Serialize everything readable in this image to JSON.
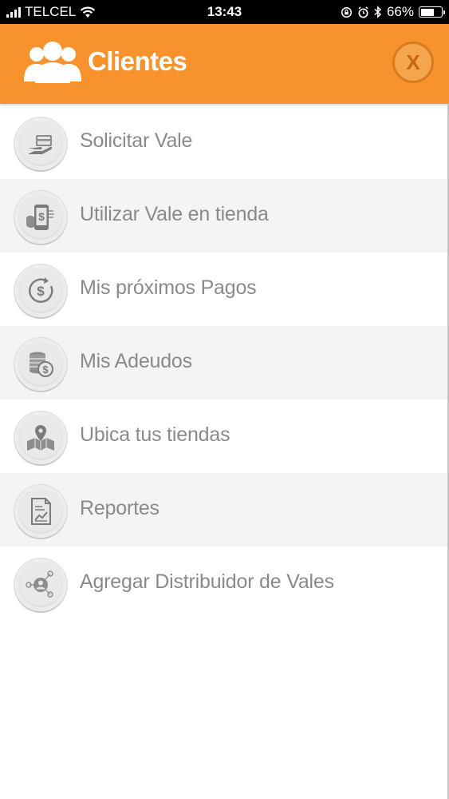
{
  "status_bar": {
    "carrier": "TELCEL",
    "time": "13:43",
    "battery_percent": "66%",
    "battery_level": 0.66
  },
  "header": {
    "title": "Clientes",
    "close_label": "X",
    "background_color": "#f7922c"
  },
  "menu": {
    "items": [
      {
        "label": "Solicitar Vale",
        "icon": "hand-card-icon"
      },
      {
        "label": "Utilizar Vale en tienda",
        "icon": "phone-money-icon"
      },
      {
        "label": "Mis próximos Pagos",
        "icon": "dollar-cycle-icon"
      },
      {
        "label": "Mis Adeudos",
        "icon": "coins-icon"
      },
      {
        "label": "Ubica tus tiendas",
        "icon": "map-pin-icon"
      },
      {
        "label": "Reportes",
        "icon": "report-icon"
      },
      {
        "label": "Agregar Distribuidor de Vales",
        "icon": "network-user-icon"
      }
    ]
  }
}
